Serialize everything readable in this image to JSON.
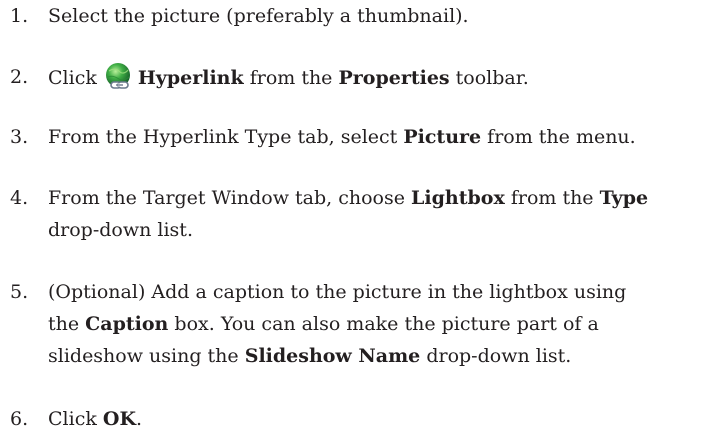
{
  "steps": [
    {
      "number": "1.",
      "text": "Select the picture (preferably a thumbnail)."
    },
    {
      "number": "2.",
      "pre": "Click",
      "icon": "hyperlink-globe-chain-icon",
      "bold1": "Hyperlink",
      "mid1": "from the",
      "bold2": "Properties",
      "post": "toolbar."
    },
    {
      "number": "3.",
      "pre": "From the Hyperlink Type tab, select",
      "bold1": "Picture",
      "post": "from the menu."
    },
    {
      "number": "4.",
      "pre": "From the Target Window tab, choose",
      "bold1": "Lightbox",
      "mid1": "from the",
      "bold2": "Type",
      "line2": "drop-down list."
    },
    {
      "number": "5.",
      "line1": "(Optional) Add a caption to the picture in the lightbox using",
      "pre2": "the",
      "bold1": "Caption",
      "mid2": "box. You can also make the picture part of a",
      "pre3": "slideshow using the",
      "bold2": "Slideshow Name",
      "post3": "drop-down list."
    },
    {
      "number": "6.",
      "pre": "Click",
      "bold1": "OK",
      "post": "."
    }
  ]
}
